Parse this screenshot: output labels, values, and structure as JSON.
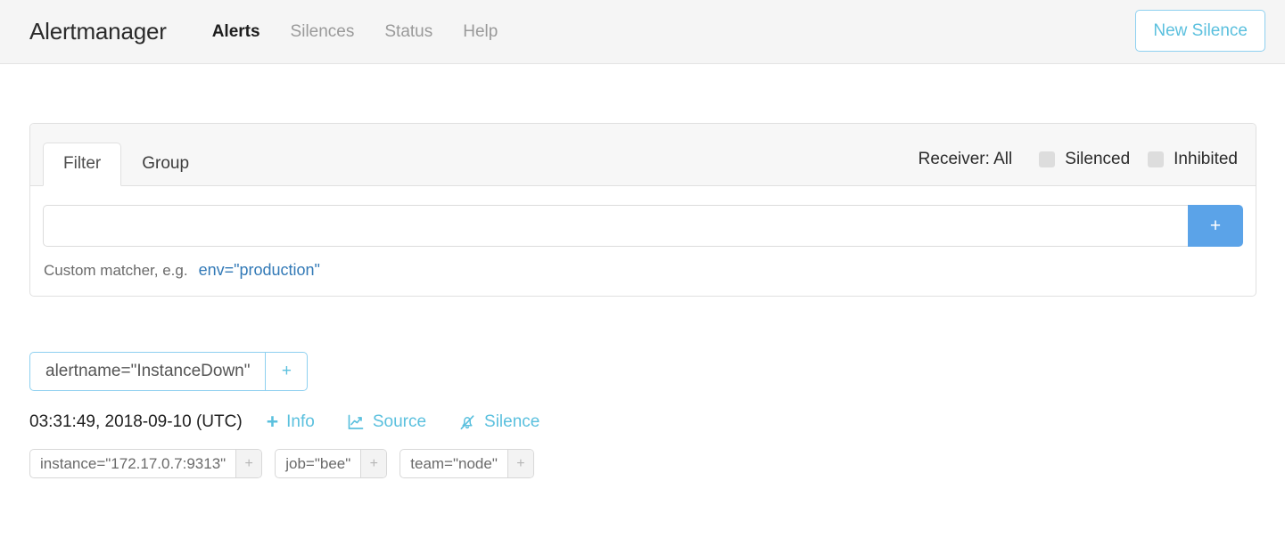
{
  "navbar": {
    "brand": "Alertmanager",
    "links": [
      {
        "label": "Alerts",
        "active": true
      },
      {
        "label": "Silences",
        "active": false
      },
      {
        "label": "Status",
        "active": false
      },
      {
        "label": "Help",
        "active": false
      }
    ],
    "new_silence_label": "New Silence"
  },
  "filter_card": {
    "tabs": [
      {
        "label": "Filter",
        "active": true
      },
      {
        "label": "Group",
        "active": false
      }
    ],
    "receiver_label": "Receiver: All",
    "checkboxes": [
      {
        "label": "Silenced",
        "checked": false
      },
      {
        "label": "Inhibited",
        "checked": false
      }
    ],
    "filter_input": {
      "value": "",
      "placeholder": ""
    },
    "add_button_label": "+",
    "hint_prefix": "Custom matcher, e.g.",
    "hint_example": "env=\"production\""
  },
  "alert_group": {
    "matcher": {
      "text": "alertname=\"InstanceDown\"",
      "plus": "+"
    },
    "alert": {
      "timestamp": "03:31:49, 2018-09-10 (UTC)",
      "actions": [
        {
          "label": "Info",
          "icon": "plus-icon"
        },
        {
          "label": "Source",
          "icon": "chart-line-icon"
        },
        {
          "label": "Silence",
          "icon": "bell-slash-icon"
        }
      ],
      "labels": [
        {
          "text": "instance=\"172.17.0.7:9313\"",
          "plus": "+"
        },
        {
          "text": "job=\"bee\"",
          "plus": "+"
        },
        {
          "text": "team=\"node\"",
          "plus": "+"
        }
      ]
    }
  },
  "colors": {
    "accent_blue": "#5bc0de",
    "button_blue": "#5ba3e8",
    "link_blue": "#337ab7",
    "navbar_bg": "#f5f5f5"
  }
}
